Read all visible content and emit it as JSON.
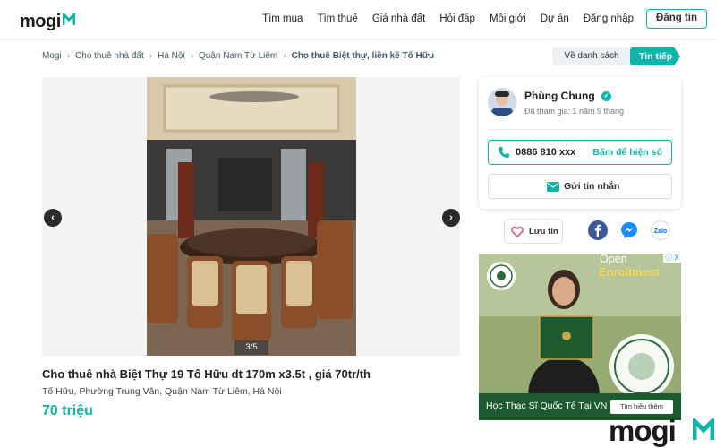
{
  "header": {
    "logo": "mogi",
    "nav": [
      "Tìm mua",
      "Tìm thuê",
      "Giá nhà đất",
      "Hỏi đáp",
      "Môi giới",
      "Dự án",
      "Đăng nhập"
    ],
    "register": "Đăng tin"
  },
  "breadcrumb": [
    "Mogi",
    "Cho thuê nhà đất",
    "Hà Nội",
    "Quận Nam Từ Liêm",
    "Cho thuê Biệt thự, liền kề Tố Hữu"
  ],
  "actions": {
    "back": "Về danh sách",
    "next": "Tin tiếp"
  },
  "gallery": {
    "counter": "3/5"
  },
  "listing": {
    "title": "Cho thuê nhà Biệt Thự 19 Tố Hữu dt 170m x3.5t , giá 70tr/th",
    "address": "Tố Hữu, Phường Trung Văn, Quận Nam Từ Liêm, Hà Nội",
    "price": "70 triệu"
  },
  "agent": {
    "name": "Phùng Chung",
    "joined": "Đã tham gia: 1 năm 9 tháng",
    "phone": "0886 810 xxx",
    "reveal": "Bấm để hiện số",
    "message": "Gửi tin nhắn"
  },
  "share": {
    "save": "Lưu tin",
    "zalo": "Zalo"
  },
  "ad": {
    "headline_1": "Open",
    "headline_2": "Enrollment",
    "text": "Học Thạc Sĩ Quốc Tế Tại VN",
    "cta": "Tìm hiểu thêm",
    "close": "ⓘ X"
  },
  "watermark": "mogi",
  "colors": {
    "brand": "#10b5aa",
    "facebook": "#3b5998",
    "ad_bg": "#1d5a2f"
  }
}
